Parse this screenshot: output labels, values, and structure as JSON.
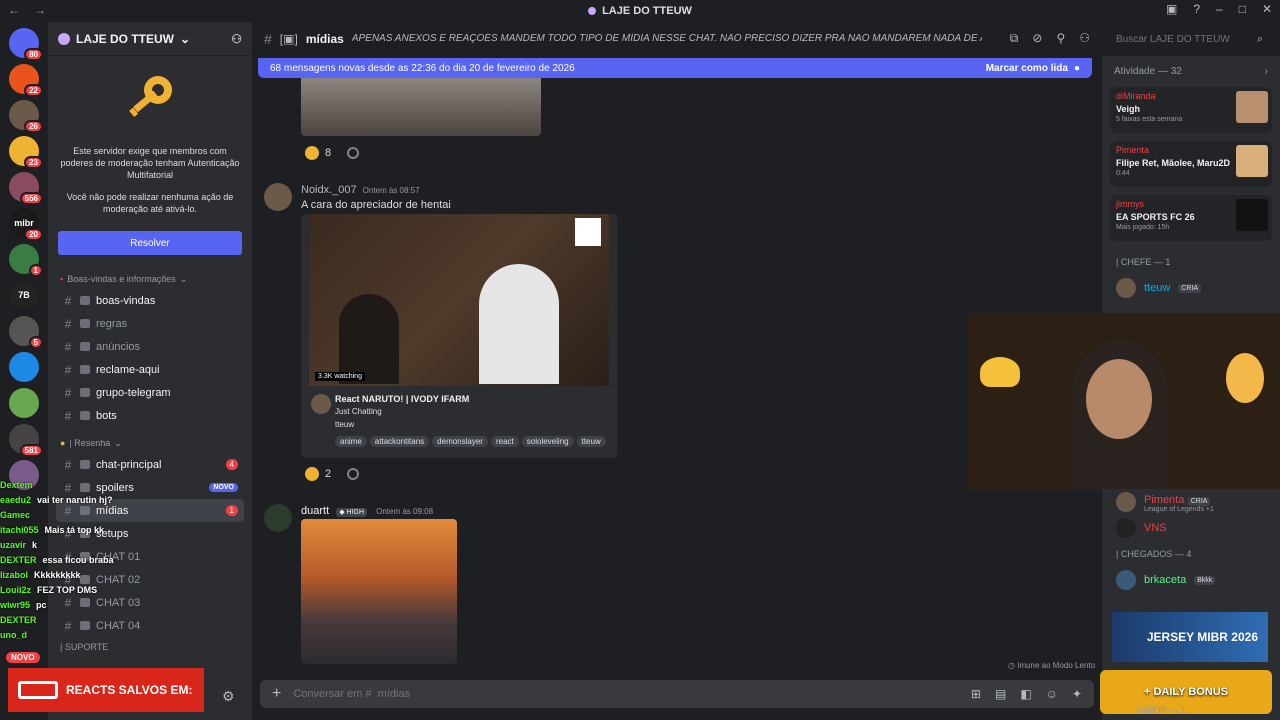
{
  "window": {
    "title": "LAJE DO TTEUW"
  },
  "guilds": [
    {
      "label": "",
      "badge": "80",
      "color": "#5865f2"
    },
    {
      "label": "",
      "badge": "22",
      "color": "#e8541c"
    },
    {
      "label": "",
      "badge": "26",
      "color": "#6b5a4a"
    },
    {
      "label": "",
      "badge": "23",
      "color": "#f0b232"
    },
    {
      "label": "",
      "badge": "556",
      "color": "#8a4b5e"
    },
    {
      "label": "mibr",
      "badge": "20",
      "color": "#1a1a1a"
    },
    {
      "label": "",
      "badge": "1",
      "color": "#3a7d44"
    },
    {
      "label": "7B",
      "badge": "",
      "color": "#222222"
    },
    {
      "label": "",
      "badge": "5",
      "color": "#555555"
    },
    {
      "label": "",
      "badge": "",
      "color": "#1e88e5"
    },
    {
      "label": "",
      "badge": "",
      "color": "#6aa84f"
    },
    {
      "label": "",
      "badge": "581",
      "color": "#444444"
    },
    {
      "label": "",
      "badge": "",
      "color": "#7a5c8a"
    }
  ],
  "server": {
    "name": "LAJE DO TTEUW",
    "mfa_text_1": "Este servidor exige que membros com poderes de moderação tenham Autenticação Multifatorial",
    "mfa_text_2": "Você não pode realizar nenhuma ação de moderação até ativá-lo.",
    "resolve_label": "Resolver"
  },
  "channels": {
    "cat1": "Boas-vindas e informações",
    "items1": [
      {
        "name": "boas-vindas"
      },
      {
        "name": "regras"
      },
      {
        "name": "anúncios"
      },
      {
        "name": "reclame-aqui"
      },
      {
        "name": "grupo-telegram"
      },
      {
        "name": "bots"
      }
    ],
    "cat2": "| Resenha",
    "items2": [
      {
        "name": "chat-principal",
        "badge": "4"
      },
      {
        "name": "spoilers",
        "badge": "NOVO"
      },
      {
        "name": "mídias",
        "badge": "1"
      },
      {
        "name": "setups"
      },
      {
        "name": "CHAT 01"
      },
      {
        "name": "CHAT 02"
      },
      {
        "name": "CHAT 03"
      },
      {
        "name": "CHAT 04"
      }
    ],
    "cat3": "| SUPORTE"
  },
  "overlay_chat": [
    {
      "user": "Dextem",
      "msg": ""
    },
    {
      "user": "eaedu2",
      "msg": "vai ter narutin hj?"
    },
    {
      "user": "Gamec",
      "msg": ""
    },
    {
      "user": "itachi055",
      "msg": "Mais tá top kk"
    },
    {
      "user": "uzavir",
      "msg": "k"
    },
    {
      "user": "DEXTER",
      "msg": "essa ficou braba"
    },
    {
      "user": "lizabol",
      "msg": "Kkkkkkkkk"
    },
    {
      "user": "Louii2z",
      "msg": "FEZ TOP DMS"
    },
    {
      "user": "wiwr95",
      "msg": "pc"
    },
    {
      "user": "DEXTER",
      "msg": ""
    },
    {
      "user": "uno_d",
      "msg": ""
    }
  ],
  "novo_badge": "NOVO",
  "reacts_banner": "REACTS SALVOS EM:",
  "header": {
    "channel_name": "mídias",
    "topic": "APENAS ANEXOS E REAÇÕES MANDEM TODO TIPO DE MÍDIA NESSE CHAT. NÃO PRECISO DIZER PRA NAO MANDAREM NADA DE ABSURDO NÉ? RESP...",
    "search_placeholder": "Buscar LAJE DO TTEUW"
  },
  "new_messages_bar": {
    "text": "68 mensagens novas desde as 22:36 do dia 20 de fevereiro de 2026",
    "action": "Marcar como lida"
  },
  "messages": [
    {
      "reaction_count": "8"
    },
    {
      "author": "Noidx._007",
      "timestamp": "Ontem às 08:57",
      "text": "A cara do apreciador de hentai",
      "embed": {
        "live": "3.3K watching",
        "title": "React NARUTO! | IVODY IFARM",
        "category": "Just Chatting",
        "channel": "tteuw",
        "tags": [
          "anime",
          "attackontitans",
          "demonslayer",
          "react",
          "sololeveling",
          "tteuw"
        ]
      },
      "reaction_count": "2"
    },
    {
      "author": "duartt",
      "badge": "HIGH",
      "timestamp": "Ontem às 09:08"
    }
  ],
  "composer": {
    "placeholder": "Conversar em #  mídias"
  },
  "slow_mode": "Imune ao Modo Lento",
  "activity": {
    "title": "Atividade — 32",
    "cards": [
      {
        "user": "diMiranda",
        "title": "Veigh",
        "sub": "5 faixas esta semana"
      },
      {
        "user": "Pimenta",
        "title": "Filipe Ret, Mãolee, Maru2D",
        "sub": "0:44"
      },
      {
        "user": "jimmys",
        "title": "EA SPORTS FC 26",
        "sub": "Mais jogado: 15h"
      }
    ]
  },
  "members": {
    "role1": "| CHEFE — 1",
    "chefe": [
      {
        "name": "tteuw",
        "tag": "CRIA"
      }
    ],
    "pimenta": {
      "name": "Pimenta",
      "tag": "CRIA",
      "status": "League of Legends +1"
    },
    "vns": "VNS",
    "role2": "| CHEGADOS — 4",
    "chegados": [
      {
        "name": "brkaceta",
        "tag": "Bkkk"
      }
    ],
    "role3": "VAPOR — 1"
  },
  "promo": {
    "jersey": "JERSEY MIBR 2026",
    "bonus": "+ DAILY BONUS"
  }
}
